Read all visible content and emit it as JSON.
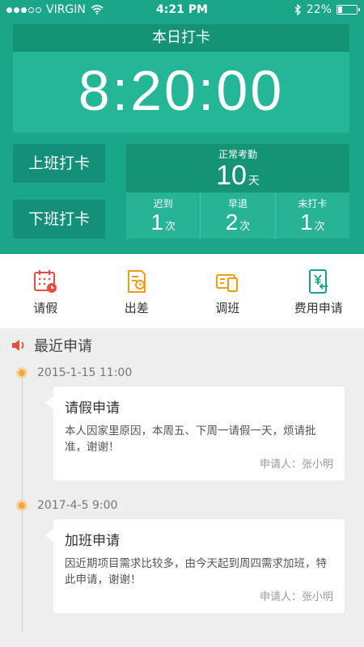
{
  "status_bar": {
    "carrier": "VIRGIN",
    "time": "4:21 PM",
    "battery": "22%",
    "battery_level": 0.22,
    "signal_filled": 3,
    "signal_total": 5
  },
  "clock": {
    "title": "本日打卡",
    "time": "8:20:00"
  },
  "buttons": {
    "clock_in": "上班打卡",
    "clock_out": "下班打卡"
  },
  "stats": {
    "normal": {
      "label": "正常考勤",
      "value": "10",
      "unit": "天"
    },
    "items": [
      {
        "label": "迟到",
        "value": "1",
        "unit": "次"
      },
      {
        "label": "早退",
        "value": "2",
        "unit": "次"
      },
      {
        "label": "未打卡",
        "value": "1",
        "unit": "次"
      }
    ]
  },
  "actions": [
    {
      "label": "请假",
      "icon": "calendar-icon",
      "color": "#e74c3c"
    },
    {
      "label": "出差",
      "icon": "trip-document-icon",
      "color": "#f39c12"
    },
    {
      "label": "调班",
      "icon": "shift-swap-icon",
      "color": "#f39c12"
    },
    {
      "label": "费用申请",
      "icon": "expense-icon",
      "color": "#16a085"
    }
  ],
  "recent": {
    "title": "最近申请",
    "items": [
      {
        "date": "2015-1-15  11:00",
        "title": "请假申请",
        "body": "本人因家里原因，本周五、下周一请假一天，烦请批准，谢谢！",
        "applicant": "申请人：张小明"
      },
      {
        "date": "2017-4-5  9:00",
        "title": "加班申请",
        "body": "因近期项目需求比较多，由今天起到周四需求加班，特此申请，谢谢！",
        "applicant": "申请人：张小明"
      }
    ]
  },
  "colors": {
    "brand_green": "#1aa688",
    "accent_orange": "#f6a346",
    "alert_red": "#e74c3c"
  }
}
